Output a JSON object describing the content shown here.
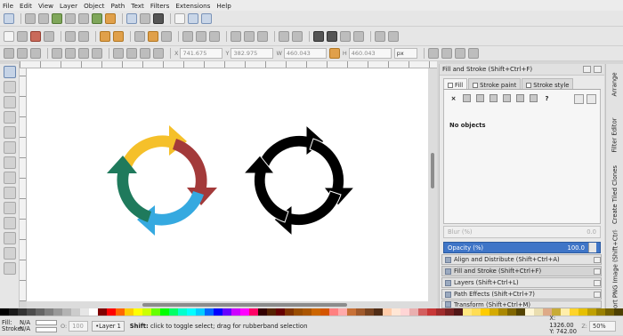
{
  "menu": [
    "File",
    "Edit",
    "View",
    "Layer",
    "Object",
    "Path",
    "Text",
    "Filters",
    "Extensions",
    "Help"
  ],
  "toolbar3": {
    "x_label": "X",
    "x_value": "741.675",
    "y_label": "Y",
    "y_value": "382.975",
    "w_label": "W",
    "w_value": "460.043",
    "h_label": "H",
    "h_value": "460.043",
    "unit": "px"
  },
  "panel": {
    "title": "Fill and Stroke (Shift+Ctrl+F)",
    "tabs": [
      "Fill",
      "Stroke paint",
      "Stroke style"
    ],
    "paint_x": "×",
    "paint_unknown": "?",
    "no_objects": "No objects",
    "blur_label": "Blur (%)",
    "blur_value": "0.0",
    "opacity_label": "Opacity (%)",
    "opacity_value": "100.0",
    "docks": [
      "Align and Distribute (Shift+Ctrl+A)",
      "Fill and Stroke (Shift+Ctrl+F)",
      "Layers (Shift+Ctrl+L)",
      "Path Effects  (Shift+Ctrl+7)",
      "Transform (Shift+Ctrl+M)"
    ]
  },
  "vtabs": [
    "Arrange",
    "Filter Editor",
    "Create Tiled Clones",
    "Export PNG Image (Shift+Ctrl+E)"
  ],
  "status": {
    "fill_label": "Fill:",
    "fill_value": "N/A",
    "stroke_label": "Stroke:",
    "stroke_value": "N/A",
    "o_label": "O:",
    "o_value": "100",
    "layer": "•Layer 1",
    "message_key": "Shift:",
    "message": " click to toggle select; drag for rubberband selection",
    "x_label": "X:",
    "x_value": "1326.00",
    "y_label": "Y:",
    "y_value": "742.00",
    "z_label": "Z:",
    "zoom": "50%"
  },
  "colors": {
    "accent": "#3f75c7",
    "arrow_yellow": "#f5c02a",
    "arrow_red": "#a33a3a",
    "arrow_blue": "#35a9e0",
    "arrow_green": "#1f7a5c",
    "arrow_black": "#000000"
  },
  "palette": [
    "#000000",
    "#1a1a1a",
    "#333333",
    "#4d4d4d",
    "#666666",
    "#808080",
    "#999999",
    "#b3b3b3",
    "#cccccc",
    "#e6e6e6",
    "#ffffff",
    "#800000",
    "#ff0000",
    "#ff6600",
    "#ffcc00",
    "#ffff00",
    "#ccff00",
    "#66ff00",
    "#00ff00",
    "#00ff66",
    "#00ffcc",
    "#00ffff",
    "#00ccff",
    "#0066ff",
    "#0000ff",
    "#6600ff",
    "#cc00ff",
    "#ff00ff",
    "#ff0066",
    "#330000",
    "#552200",
    "#660000",
    "#803300",
    "#994d00",
    "#aa5500",
    "#cc6600",
    "#d45500",
    "#ff8080",
    "#ffaaaa",
    "#c87137",
    "#a05a2c",
    "#784421",
    "#502d16",
    "#ffccaa",
    "#ffe6d5",
    "#ffd5d5",
    "#e9afaf",
    "#d35f5f",
    "#c83737",
    "#a02c2c",
    "#782121",
    "#501616",
    "#ffe680",
    "#ffdd55",
    "#ffcc00",
    "#d4aa00",
    "#aa8800",
    "#806600",
    "#554400",
    "#fff6d5",
    "#e9ddaf",
    "#deaa87",
    "#c8ab37",
    "#ffeeaa",
    "#ffd42a",
    "#e6c000",
    "#bfa000",
    "#998000",
    "#736000",
    "#4d4000"
  ]
}
